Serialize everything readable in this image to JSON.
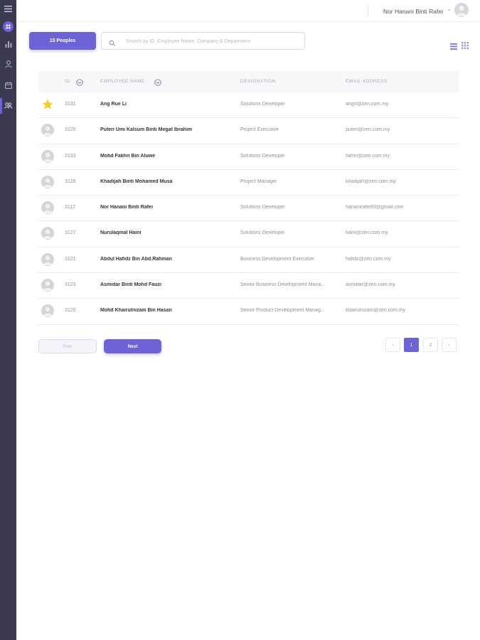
{
  "topbar": {
    "user_name": "Nor Hanani Binti Rafei"
  },
  "toolbar": {
    "people_count_label": "15 Peoples",
    "search_placeholder": "Search by ID, Employee Name, Company & Department",
    "search_value": ""
  },
  "table": {
    "headers": {
      "id": "ID",
      "name": "EMPLOYEE NAME",
      "designation": "DESIGNATION",
      "email": "EMAIL ADDRESS"
    },
    "rows": [
      {
        "avatar": "star",
        "id": "3131",
        "name": "Ang Rue Li",
        "designation": "Solutions Developer",
        "email": "angrl@zen.com.my"
      },
      {
        "avatar": "person",
        "id": "3125",
        "name": "Puteri Umi Kalsum Binti Megat Ibrahim",
        "designation": "Project Executive",
        "email": "puteri@zen.com.my"
      },
      {
        "avatar": "person",
        "id": "3133",
        "name": "Mohd Fakhri Bin Aluwe",
        "designation": "Solutions Developer",
        "email": "fakhri@zen.com.my"
      },
      {
        "avatar": "person",
        "id": "3126",
        "name": "Khadijah Binti Mohamed Musa",
        "designation": "Project Manager",
        "email": "khadijah@zen.com.my"
      },
      {
        "avatar": "person",
        "id": "3112",
        "name": "Nor Hanani Binti Rafei",
        "designation": "Solutions Developer",
        "email": "hananirafei93@gmail.com"
      },
      {
        "avatar": "person",
        "id": "3127",
        "name": "Nurulaqmal Haini",
        "designation": "Solutions Developer",
        "email": "haini@zen.com.my"
      },
      {
        "avatar": "person",
        "id": "3121",
        "name": "Abdul Hafidz Bin Abd.Rahman",
        "designation": "Business Development Executive",
        "email": "hafidz@zen.com.my"
      },
      {
        "avatar": "person",
        "id": "3123",
        "name": "Asmidar Binti Mohd Fauzi",
        "designation": "Senior Business Development Mana...",
        "email": "asmidar@zen.com.my"
      },
      {
        "avatar": "person",
        "id": "3120",
        "name": "Mohd Khairulnizam Bin Hasan",
        "designation": "Senior Product Development Manag...",
        "email": "khairulnizam@zen.com.my"
      }
    ]
  },
  "pagination": {
    "prev_label": "Prev",
    "next_label": "Next",
    "prev_arrow": "‹",
    "next_arrow": "›",
    "pages": [
      "1",
      "2"
    ],
    "current_page": "1"
  },
  "colors": {
    "accent": "#6c63d6",
    "sidebar": "#3b3a52",
    "star": "#f5cc2f"
  }
}
